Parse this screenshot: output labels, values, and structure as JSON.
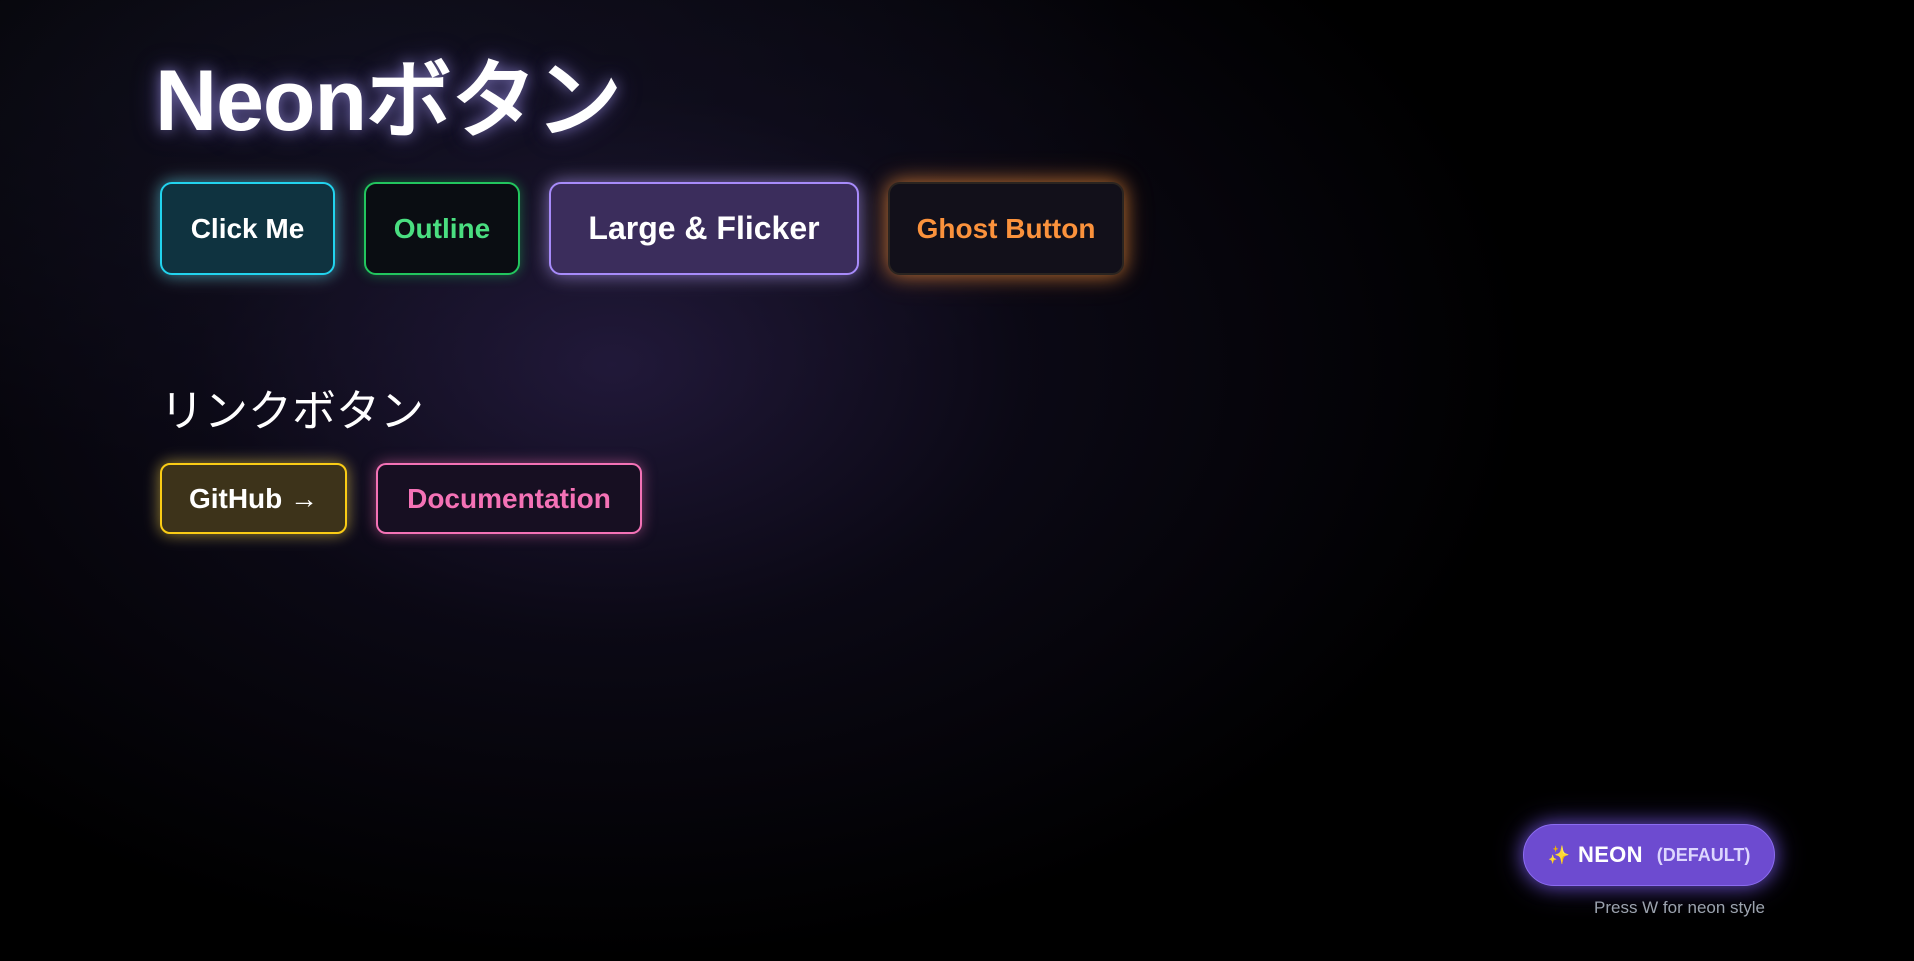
{
  "page": {
    "title": "Neonボタン"
  },
  "buttons": [
    {
      "label": "Click Me",
      "color": "#22d3ee"
    },
    {
      "label": "Outline",
      "color": "#22c55e"
    },
    {
      "label": "Large & Flicker",
      "color": "#a78bfa"
    },
    {
      "label": "Ghost Button",
      "color": "#fb923c"
    }
  ],
  "link_section": {
    "heading": "リンクボタン",
    "links": [
      {
        "label": "GitHub →",
        "color": "#facc15"
      },
      {
        "label": "Documentation",
        "color": "#f472b6"
      }
    ]
  },
  "style_switcher": {
    "icon": "sparkles-icon",
    "icon_glyph": "✨",
    "label": "NEON",
    "note": "(DEFAULT)",
    "color": "#6d4bd0",
    "hint": "Press W for neon style"
  }
}
